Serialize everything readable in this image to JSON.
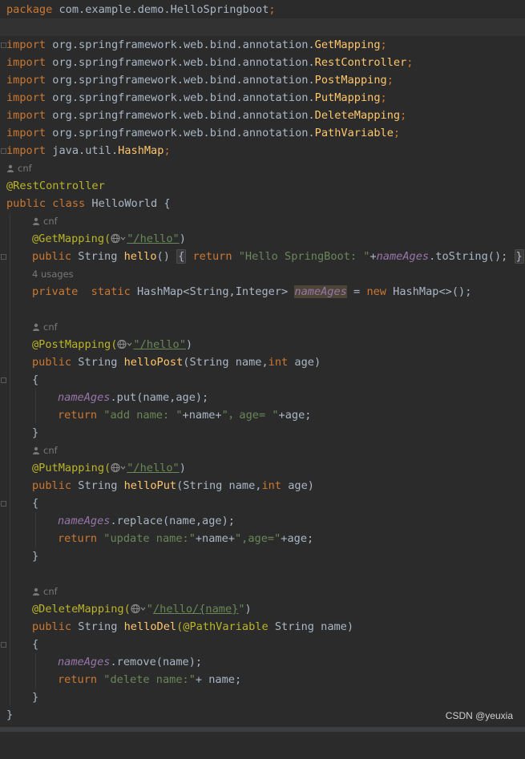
{
  "editor": {
    "package_kw": "package",
    "package_name": " com.example.demo.HelloSpringboot",
    "semicolon": ";",
    "import_kw": "import",
    "imports": [
      {
        "prefix": " org.springframework.web.bind.annotation.",
        "name": "GetMapping"
      },
      {
        "prefix": " org.springframework.web.bind.annotation.",
        "name": "RestController"
      },
      {
        "prefix": " org.springframework.web.bind.annotation.",
        "name": "PostMapping"
      },
      {
        "prefix": " org.springframework.web.bind.annotation.",
        "name": "PutMapping"
      },
      {
        "prefix": " org.springframework.web.bind.annotation.",
        "name": "DeleteMapping"
      },
      {
        "prefix": " org.springframework.web.bind.annotation.",
        "name": "PathVariable"
      },
      {
        "prefix": " java.util.",
        "name": "HashMap"
      }
    ],
    "author_hint": "cnf",
    "usages_hint": "4 usages",
    "class_annotation": "@RestController",
    "class_decl": {
      "public": "public",
      "class": "class",
      "name": " HelloWorld {"
    },
    "get_annotation": "@GetMapping(",
    "get_url": "\"/hello\"",
    "close_paren": ")",
    "hello_method": {
      "public": "public",
      "type": " String ",
      "name": "hello",
      "parens": "() ",
      "fold_open": "{",
      "return": " return ",
      "str": "\"Hello SpringBoot: \"",
      "plus": "+",
      "field": "nameAges",
      "call": ".toString();",
      "fold_close": "}"
    },
    "field_decl": {
      "private": "private",
      "static": "static",
      "type": " HashMap<String,Integer> ",
      "name": "nameAges",
      "eq": " = ",
      "new": "new",
      "rest": " HashMap<>();"
    },
    "post_annotation": "@PostMapping(",
    "post_url": "\"/hello\"",
    "post_method": {
      "public": "public",
      "type": " String ",
      "name": "helloPost",
      "open": "(String name,",
      "int": "int",
      "rest": " age)"
    },
    "open_brace": "{",
    "close_brace": "}",
    "post_body": {
      "field": "nameAges",
      "call": ".put(name,age);",
      "return": "return",
      "str1": "\"add name: \"",
      "mid": "+name+",
      "str2": "\"，age= \"",
      "end": "+age;"
    },
    "put_annotation": "@PutMapping(",
    "put_url": "\"/hello\"",
    "put_method": {
      "public": "public",
      "type": " String ",
      "name": "helloPut",
      "open": "(String name,",
      "int": "int",
      "rest": " age)"
    },
    "put_body": {
      "field": "nameAges",
      "call": ".replace(name,age);",
      "return": "return",
      "str1": "\"update name:\"",
      "mid": "+name+",
      "str2": "\",age=\"",
      "end": "+age;"
    },
    "delete_annotation": "@DeleteMapping(",
    "delete_url_q1": "\"",
    "delete_url_path": "/hello/",
    "delete_url_var": "{name}",
    "delete_url_q2": "\"",
    "delete_method": {
      "public": "public",
      "type": " String ",
      "name": "helloDel",
      "pv": "(@PathVariable",
      "rest": " String name)"
    },
    "delete_body": {
      "field": "nameAges",
      "call": ".remove(name);",
      "return": "return",
      "str": "\"delete name:\"",
      "end": "+ name;"
    },
    "class_close": "}"
  },
  "watermark": "CSDN @yeuxia",
  "colors": {
    "background": "#2b2b2b",
    "keyword": "#cc7832",
    "string": "#6a8759",
    "annotation": "#bbb529",
    "field": "#9876aa",
    "method": "#ffc66d",
    "text": "#a9b7c6"
  },
  "icons": [
    "user-icon",
    "globe-icon",
    "fold-icon"
  ]
}
